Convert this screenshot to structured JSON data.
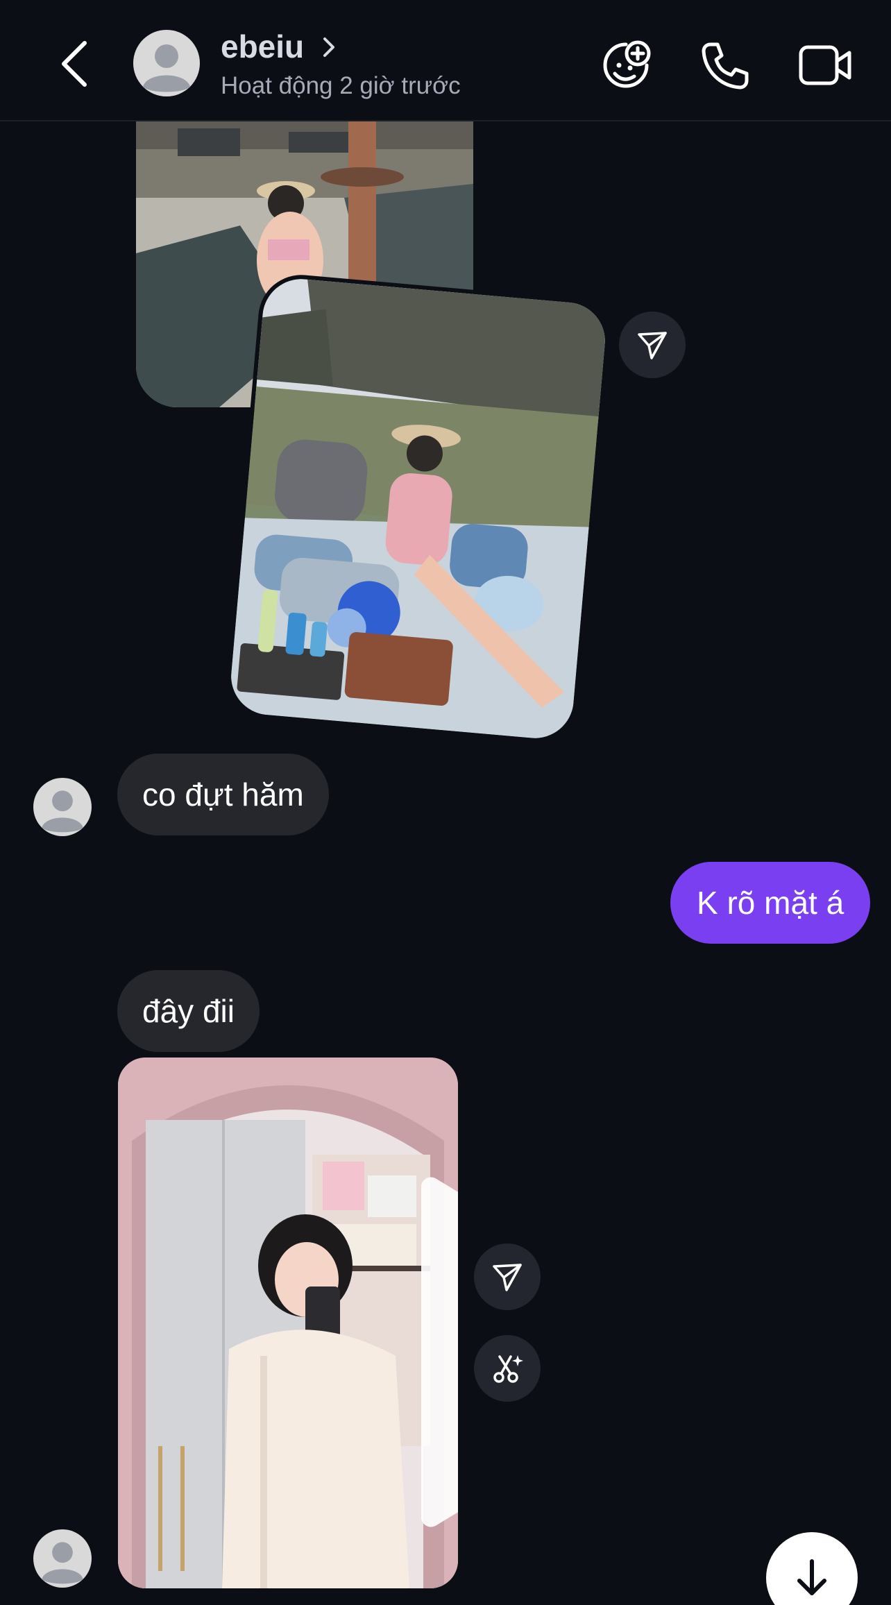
{
  "header": {
    "contact_name": "ebeiu",
    "status": "Hoạt động 2 giờ trước",
    "icons": [
      "back-arrow-icon",
      "avatar",
      "chevron-right-icon",
      "sticker-add-icon",
      "phone-icon",
      "video-camera-icon"
    ]
  },
  "messages": [
    {
      "type": "image_group",
      "sender": "them",
      "images": [
        "beach-photo",
        "boat-photo"
      ]
    },
    {
      "type": "text",
      "sender": "them",
      "text": "co đựt hăm"
    },
    {
      "type": "text",
      "sender": "me",
      "text": "K rõ mặt á"
    },
    {
      "type": "text",
      "sender": "them",
      "text": "đây đii"
    },
    {
      "type": "video",
      "sender": "them"
    }
  ],
  "actions": [
    "share-icon",
    "ai-edit-icon",
    "scroll-down-icon"
  ],
  "colors": {
    "background": "#0b0e14",
    "incoming_bubble": "#25272d",
    "outgoing_bubble": "#7b3ff2",
    "round_button": "#23262e"
  }
}
